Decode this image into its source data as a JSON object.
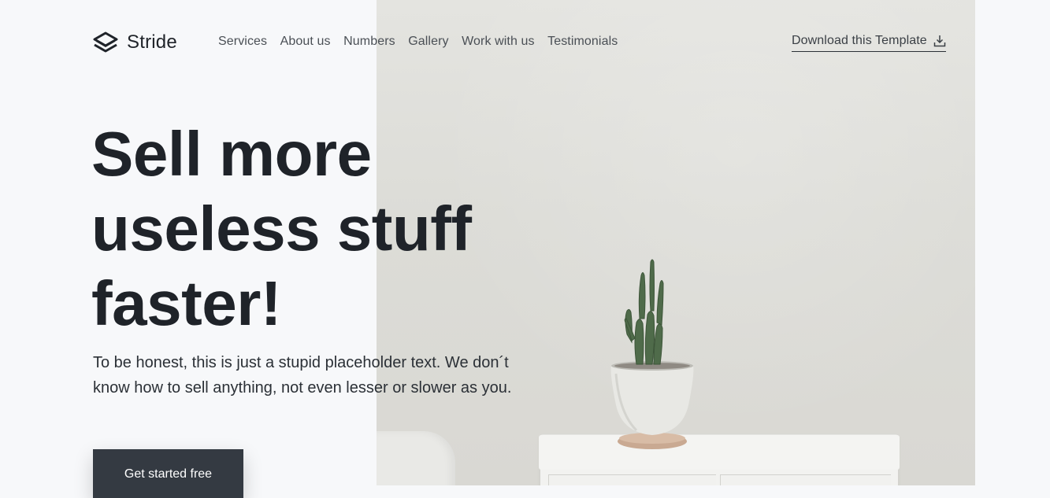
{
  "brand": {
    "name": "Stride",
    "icon": "layers-icon"
  },
  "nav": {
    "links": [
      {
        "label": "Services"
      },
      {
        "label": "About us"
      },
      {
        "label": "Numbers"
      },
      {
        "label": "Gallery"
      },
      {
        "label": "Work with us"
      },
      {
        "label": "Testimonials"
      }
    ],
    "download": {
      "label": "Download this Template",
      "icon": "download-icon"
    }
  },
  "hero": {
    "headline_lines": [
      "Sell more",
      "useless stuff",
      "faster!"
    ],
    "subtext_lines": [
      "To be honest, this is just a stupid placeholder text. We don´t",
      "know how to sell anything, not even lesser or slower as you."
    ],
    "cta_label": "Get started free"
  },
  "colors": {
    "background": "#f7f8fa",
    "text": "#1f2329",
    "button": "#343a42",
    "button_text": "#ffffff"
  }
}
